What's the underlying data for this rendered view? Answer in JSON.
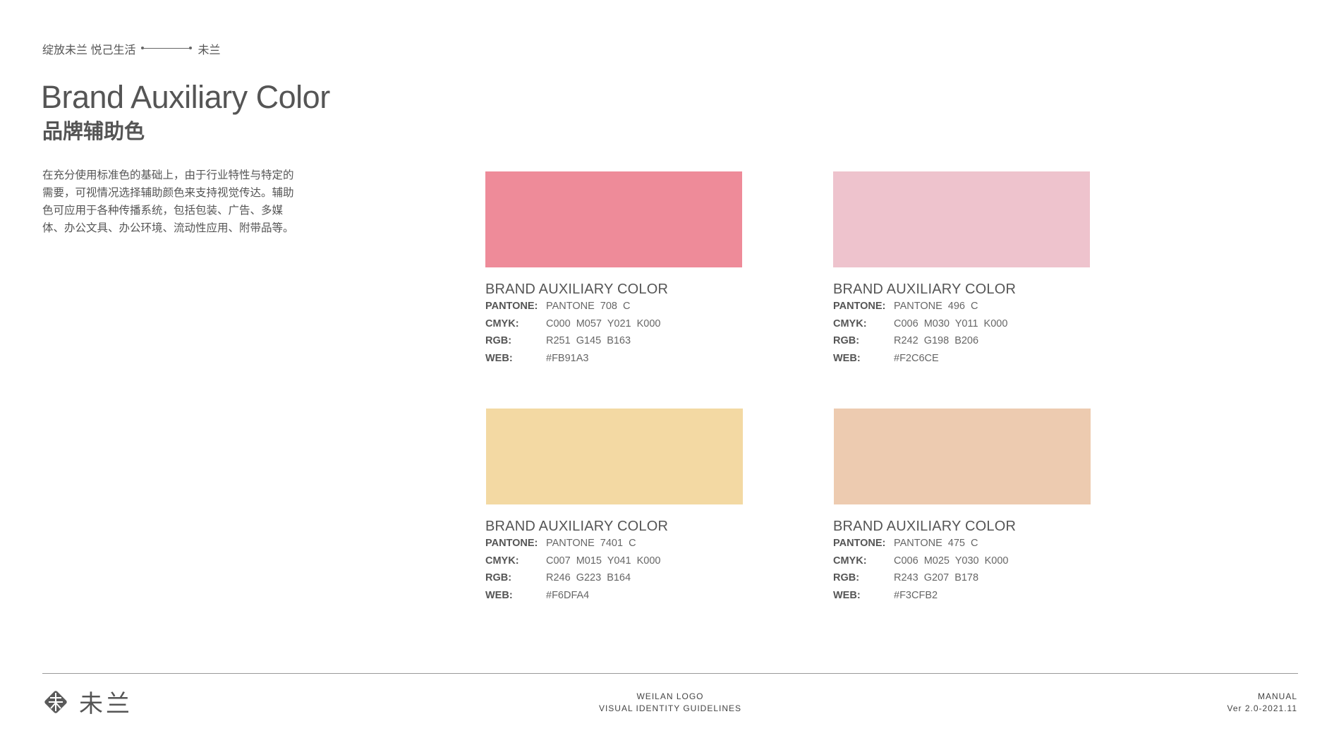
{
  "header": {
    "breadcrumb_left": "绽放未兰 悦己生活",
    "breadcrumb_right": "未兰",
    "title_en": "Brand Auxiliary Color",
    "title_cn": "品牌辅助色"
  },
  "intro_text": "在充分使用标准色的基础上，由于行业特性与特定的需要，可视情况选择辅助颜色来支持视觉传达。辅助色可应用于各种传播系统，包括包装、广告、多媒体、办公文具、办公环境、流动性应用、附带品等。",
  "spec_labels": {
    "pantone": "PANTONE:",
    "cmyk": "CMYK:",
    "rgb": "RGB:",
    "web": "WEB:"
  },
  "colors": [
    {
      "title": "BRAND AUXILIARY COLOR",
      "pantone": "PANTONE 708 C",
      "cmyk": "C000 M057 Y021 K000",
      "rgb": "R251 G145 B163",
      "web": "#FB91A3",
      "swatch": "#EE8B99"
    },
    {
      "title": "BRAND AUXILIARY COLOR",
      "pantone": "PANTONE 496 C",
      "cmyk": "C006 M030 Y011 K000",
      "rgb": "R242 G198 B206",
      "web": "#F2C6CE",
      "swatch": "#EEC3CD"
    },
    {
      "title": "BRAND AUXILIARY COLOR",
      "pantone": "PANTONE 7401 C",
      "cmyk": "C007 M015 Y041 K000",
      "rgb": "R246 G223 B164",
      "web": "#F6DFA4",
      "swatch": "#F3D9A3"
    },
    {
      "title": "BRAND AUXILIARY COLOR",
      "pantone": "PANTONE 475 C",
      "cmyk": "C006 M025 Y030 K000",
      "rgb": "R243 G207 B178",
      "web": "#F3CFB2",
      "swatch": "#EDCBB0"
    }
  ],
  "footer": {
    "logo_text": "未兰",
    "center_line1": "WEILAN LOGO",
    "center_line2": "VISUAL IDENTITY GUIDELINES",
    "right_line1": "MANUAL",
    "right_line2": "Ver 2.0-2021.11"
  }
}
